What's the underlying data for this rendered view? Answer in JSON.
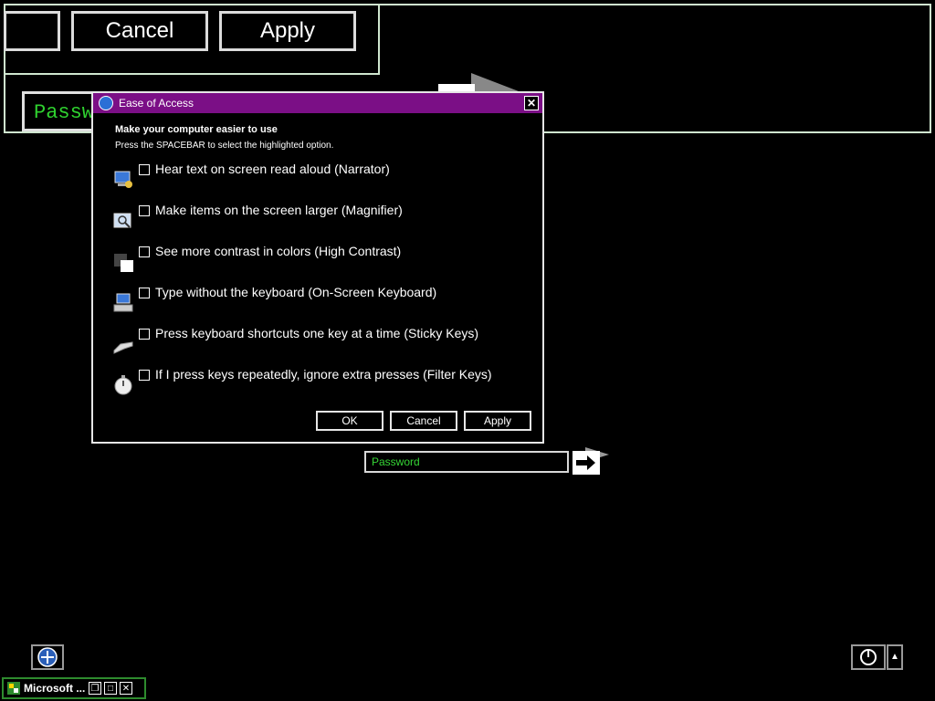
{
  "background": {
    "buttons": {
      "cancel": "Cancel",
      "apply": "Apply"
    },
    "password_value": "Passw"
  },
  "dialog": {
    "title": "Ease of Access",
    "close_glyph": "✕",
    "heading": "Make your computer easier to use",
    "subheading": "Press the SPACEBAR to select the highlighted option.",
    "options": [
      {
        "label": "Hear text on screen read aloud (Narrator)",
        "icon": "narrator-icon",
        "checked": false
      },
      {
        "label": "Make items on the screen larger (Magnifier)",
        "icon": "magnifier-icon",
        "checked": false
      },
      {
        "label": "See more contrast in colors (High Contrast)",
        "icon": "high-contrast-icon",
        "checked": false
      },
      {
        "label": "Type without the keyboard (On-Screen Keyboard)",
        "icon": "on-screen-keyboard-icon",
        "checked": false
      },
      {
        "label": "Press keyboard shortcuts one key at a time (Sticky Keys)",
        "icon": "sticky-keys-icon",
        "checked": false
      },
      {
        "label": "If I press keys repeatedly, ignore extra presses (Filter Keys)",
        "icon": "filter-keys-icon",
        "checked": false
      }
    ],
    "buttons": {
      "ok": "OK",
      "cancel": "Cancel",
      "apply": "Apply"
    }
  },
  "logon": {
    "password_placeholder": "Password"
  },
  "taskbar": {
    "label": "Microsoft ..."
  },
  "colors": {
    "titlebar": "#7b0f86",
    "password_text": "#35d435",
    "frame": "#cfe6cf"
  }
}
